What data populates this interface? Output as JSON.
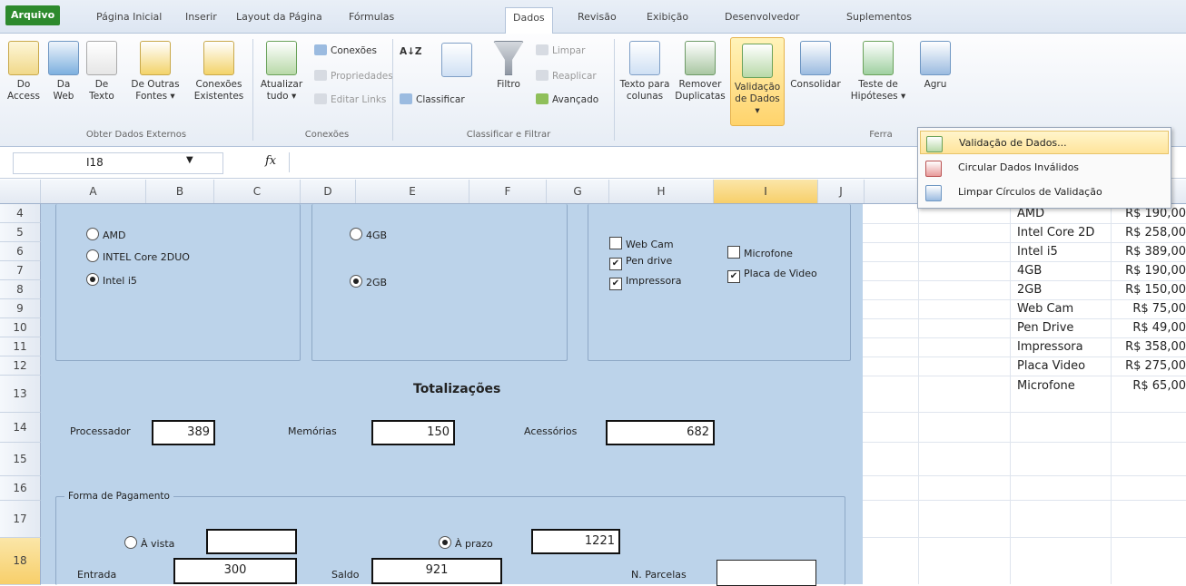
{
  "tabs": [
    "Arquivo",
    "Página Inicial",
    "Inserir",
    "Layout da Página",
    "Fórmulas",
    "Dados",
    "Revisão",
    "Exibição",
    "Desenvolvedor",
    "Suplementos"
  ],
  "ribbon": {
    "external": {
      "access": "Do Access",
      "web": "Da Web",
      "text": "De Texto",
      "other": "De Outras Fontes ▾",
      "existing": "Conexões Existentes",
      "group": "Obter Dados Externos"
    },
    "connections": {
      "refresh": "Atualizar tudo ▾",
      "connections": "Conexões",
      "properties": "Propriedades",
      "edit_links": "Editar Links",
      "group": "Conexões"
    },
    "sort": {
      "sort": "Classificar",
      "filter": "Filtro",
      "clear": "Limpar",
      "reapply": "Reaplicar",
      "advanced": "Avançado",
      "group": "Classificar e Filtrar"
    },
    "tools": {
      "text_to_columns": "Texto para colunas",
      "remove_duplicates": "Remover Duplicatas",
      "validation": "Validação de Dados ▾",
      "consolidate": "Consolidar",
      "what_if": "Teste de Hipóteses ▾",
      "group_btn": "Agru",
      "group": "Ferra"
    }
  },
  "formula_bar": {
    "name_box": "I18",
    "fx": "fx"
  },
  "columns": [
    "A",
    "B",
    "C",
    "D",
    "E",
    "F",
    "G",
    "H",
    "I",
    "J"
  ],
  "rows": [
    "4",
    "5",
    "6",
    "7",
    "8",
    "9",
    "10",
    "11",
    "12",
    "13",
    "14",
    "15",
    "16",
    "17",
    "18"
  ],
  "dropdown": {
    "items": [
      "Validação de Dados...",
      "Circular Dados Inválidos",
      "Limpar Círculos de Validação"
    ]
  },
  "form": {
    "processors": [
      "AMD",
      "INTEL Core 2DUO",
      "Intel i5"
    ],
    "processor_selected": 2,
    "memory": [
      "4GB",
      "2GB"
    ],
    "memory_selected": 1,
    "accessories": [
      {
        "label": "Web Cam",
        "checked": false
      },
      {
        "label": "Pen drive",
        "checked": true
      },
      {
        "label": "Impressora",
        "checked": true
      },
      {
        "label": "Microfone",
        "checked": false
      },
      {
        "label": "Placa de Video",
        "checked": true
      }
    ],
    "totals_title": "Totalizações",
    "proc_label": "Processador",
    "proc_value": "389",
    "mem_label": "Memórias",
    "mem_value": "150",
    "acc_label": "Acessórios",
    "acc_value": "682",
    "payment_title": "Forma de Pagamento",
    "cash_label": "À vista",
    "cash_value": "",
    "term_label": "À prazo",
    "term_value": "1221",
    "entry_label": "Entrada",
    "entry_value": "300",
    "balance_label": "Saldo",
    "balance_value": "921",
    "installments_label": "N. Parcelas",
    "installments_value": ""
  },
  "price_table": [
    {
      "item": "AMD",
      "price": "R$ 190,00"
    },
    {
      "item": "Intel Core 2D",
      "price": "R$ 258,00"
    },
    {
      "item": "Intel i5",
      "price": "R$ 389,00"
    },
    {
      "item": "4GB",
      "price": "R$ 190,00"
    },
    {
      "item": "2GB",
      "price": "R$ 150,00"
    },
    {
      "item": "Web Cam",
      "price": "R$ 75,00"
    },
    {
      "item": "Pen Drive",
      "price": "R$ 49,00"
    },
    {
      "item": "Impressora",
      "price": "R$ 358,00"
    },
    {
      "item": "Placa Video",
      "price": "R$ 275,00"
    },
    {
      "item": "Microfone",
      "price": "R$ 65,00"
    }
  ]
}
